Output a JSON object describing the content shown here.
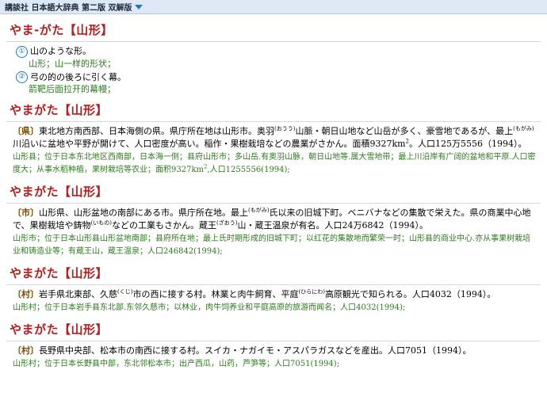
{
  "topbar": {
    "title": "講談社 日本語大辞典 第二版 双解版"
  },
  "entries": [
    {
      "headword": "やま-がた【山形】",
      "senses": [
        {
          "num": "①",
          "text": "山のような形。",
          "trans": "山形；山一样的形状；"
        },
        {
          "num": "②",
          "text": "弓の的の後ろに引く幕。",
          "trans": "箭靶后面拉开的幕幔；"
        }
      ]
    },
    {
      "headword": "やまがた【山形】",
      "tag": "〔県〕",
      "jp_a": "東北地方南西部、日本海側の県。県庁所在地は山形市。奥羽",
      "ruby_a": "(おうう)",
      "jp_b": "山脈・朝日山地など山岳が多く、豪雪地であるが、最上",
      "ruby_b": "(もがみ)",
      "jp_c": "川沿いに盆地や平野が開けて、人口密度が高い。稲作・果樹栽培などの農業がさかん。面積9327km",
      "sup_c": "2",
      "jp_d": "。人口125万5556（1994）。",
      "tr_a": "山形县；位于日本东北地区西南部，日本海一侧；县府山形市；多山岳.有奥羽山脉，朝日山地等.属大雪地带；最上川沿岸有广阔的盆地和平原.人口密度大；从事水稻种植，果树栽培等农业；面积9327km",
      "tr_sup": "2",
      "tr_b": ",人口1255556(1994);"
    },
    {
      "headword": "やまがた【山形】",
      "tag": "〔市〕",
      "jp_a": "山形県、山形盆地の南部にある市。県庁所在地。最上",
      "ruby_a": "(もがみ)",
      "jp_b": "氏以来の旧城下町。ベニバナなどの集散で栄えた。県の商業中心地で、果樹栽培や鋳物",
      "ruby_b": "(いもの)",
      "jp_c": "などの工業もさかん。蔵王",
      "ruby_c": "(ざおう)",
      "jp_d": "山・蔵王温泉が有名。人口24万6842（1994）。",
      "tr": "山形市；位于日本山形县山形盆地南部；县府所在地；最上氏时期形成的旧城下町；以红花的集散地而繁荣一时；山形县的商业中心.亦从事果树栽培业和铸造业等；有蔵王山，蔵王温泉；人口246842(1994);"
    },
    {
      "headword": "やまがた【山形】",
      "tag": "〔村〕",
      "jp_a": "岩手県北東部、久慈",
      "ruby_a": "(くじ)",
      "jp_b": "市の西に接する村。林業と肉牛飼育、平庭",
      "ruby_b": "(ひらにわ)",
      "jp_c": "高原観光で知られる。人口4032（1994）。",
      "tr": "山形村；位于日本岩手县东北部.东邻久慈市；以林业，肉牛饲养业和平庭高原的旅游而闻名；人口4032(1994);"
    },
    {
      "headword": "やまがた【山形】",
      "tag": "〔村〕",
      "jp": "長野県中央部、松本市の南西に接する村。スイカ・ナガイモ・アスパラガスなどを産出。人口7051（1994）。",
      "tr": "山形村；位于日本长野县中部，东北邻松本市；出产西瓜，山药，芦笋等；人口7051(1994);"
    }
  ]
}
